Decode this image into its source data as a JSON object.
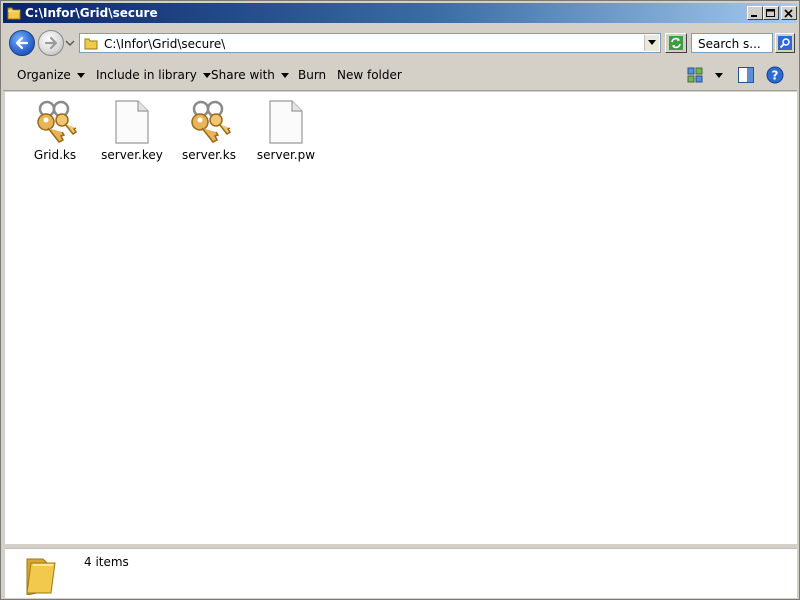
{
  "window": {
    "title": "C:\\Infor\\Grid\\secure"
  },
  "address_bar": {
    "path": "C:\\Infor\\Grid\\secure\\"
  },
  "search": {
    "placeholder": "Search s..."
  },
  "toolbar": {
    "organize": "Organize",
    "include_in_library": "Include in library",
    "share_with": "Share with",
    "burn": "Burn",
    "new_folder": "New folder"
  },
  "files": [
    {
      "name": "Grid.ks",
      "icon": "keys-icon"
    },
    {
      "name": "server.key",
      "icon": "blank-file-icon"
    },
    {
      "name": "server.ks",
      "icon": "keys-icon"
    },
    {
      "name": "server.pw",
      "icon": "blank-file-icon"
    }
  ],
  "details_pane": {
    "item_count": "4 items"
  },
  "colors": {
    "titlebar_start": "#0a246a",
    "titlebar_end": "#a6caf0",
    "window_chrome": "#d4d0c8",
    "content_bg": "#ffffff",
    "nav_back_blue": "#2e6bd1",
    "folder_yellow": "#f2c94c"
  }
}
